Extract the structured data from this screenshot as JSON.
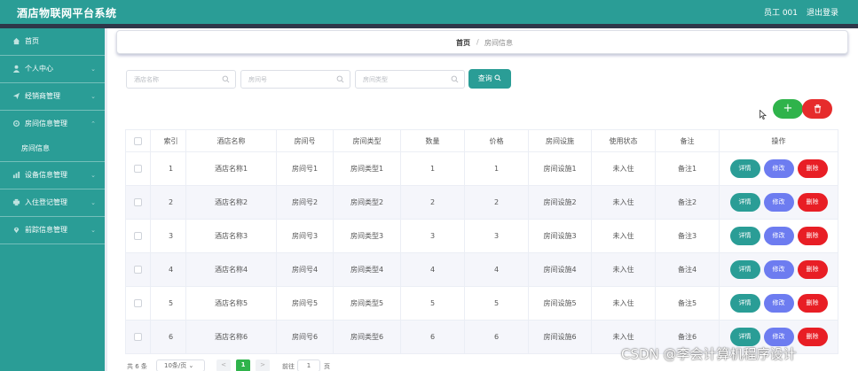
{
  "app": {
    "title": "酒店物联网平台系统",
    "user": "员工 001",
    "logout": "退出登录"
  },
  "sidebar": {
    "items": [
      {
        "label": "首页",
        "icon": "home-icon"
      },
      {
        "label": "个人中心",
        "icon": "person-icon"
      },
      {
        "label": "经销商管理",
        "icon": "send-icon"
      },
      {
        "label": "房间信息管理",
        "icon": "gear-icon"
      },
      {
        "label": "房间信息",
        "icon": ""
      },
      {
        "label": "设备信息管理",
        "icon": "chart-icon"
      },
      {
        "label": "入住登记管理",
        "icon": "printer-icon"
      },
      {
        "label": "前踪信息管理",
        "icon": "location-icon"
      }
    ]
  },
  "breadcrumb": {
    "home": "首页",
    "separator": "/",
    "current": "房间信息"
  },
  "search": {
    "hotel_placeholder": "酒店名称",
    "room_placeholder": "房间号",
    "type_placeholder": "房间类型",
    "query_label": "查询"
  },
  "toolbar": {
    "add_label": "+"
  },
  "table": {
    "headers": [
      "索引",
      "酒店名称",
      "房间号",
      "房间类型",
      "数量",
      "价格",
      "房间设施",
      "使用状态",
      "备注",
      "操作"
    ],
    "actions": {
      "detail": "详情",
      "edit": "修改",
      "remove": "删除"
    },
    "rows": [
      [
        "1",
        "酒店名称1",
        "房间号1",
        "房间类型1",
        "1",
        "1",
        "房间设施1",
        "未入住",
        "备注1"
      ],
      [
        "2",
        "酒店名称2",
        "房间号2",
        "房间类型2",
        "2",
        "2",
        "房间设施2",
        "未入住",
        "备注2"
      ],
      [
        "3",
        "酒店名称3",
        "房间号3",
        "房间类型3",
        "3",
        "3",
        "房间设施3",
        "未入住",
        "备注3"
      ],
      [
        "4",
        "酒店名称4",
        "房间号4",
        "房间类型4",
        "4",
        "4",
        "房间设施4",
        "未入住",
        "备注4"
      ],
      [
        "5",
        "酒店名称5",
        "房间号5",
        "房间类型5",
        "5",
        "5",
        "房间设施5",
        "未入住",
        "备注5"
      ],
      [
        "6",
        "酒店名称6",
        "房间号6",
        "房间类型6",
        "6",
        "6",
        "房间设施6",
        "未入住",
        "备注6"
      ]
    ]
  },
  "pagination": {
    "total": "共 6 条",
    "page_size": "10条/页",
    "prev": "<",
    "current_page": "1",
    "next": ">",
    "goto_label": "前往",
    "goto_value": "1",
    "page_word": "页"
  },
  "watermark": "CSDN @李会计算机程序设计",
  "colors": {
    "primary": "#2a9d96",
    "dark_strip": "#2e3749",
    "add": "#2fb34b",
    "delete": "#e62c2c",
    "edit": "#6d7cf0"
  }
}
